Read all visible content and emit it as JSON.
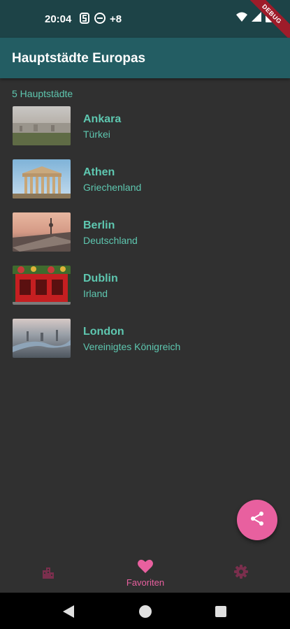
{
  "status_bar": {
    "time": "20:04",
    "more": "+8",
    "debug": "DEBUG"
  },
  "app_bar": {
    "title": "Hauptstädte Europas"
  },
  "list": {
    "count_label": "5 Hauptstädte",
    "items": [
      {
        "city": "Ankara",
        "country": "Türkei"
      },
      {
        "city": "Athen",
        "country": "Griechenland"
      },
      {
        "city": "Berlin",
        "country": "Deutschland"
      },
      {
        "city": "Dublin",
        "country": "Irland"
      },
      {
        "city": "London",
        "country": "Vereinigtes Königreich"
      }
    ]
  },
  "bottom_nav": {
    "active_label": "Favoriten",
    "items": [
      {
        "icon": "city-icon",
        "active": false
      },
      {
        "icon": "heart-icon",
        "active": true
      },
      {
        "icon": "gear-icon",
        "active": false
      }
    ]
  },
  "fab": {
    "icon": "share-icon"
  },
  "colors": {
    "accent": "#e8609f",
    "teal_text": "#5ec7b0",
    "app_bar": "#235d63",
    "status_bar": "#1d4347",
    "background": "#303030"
  }
}
